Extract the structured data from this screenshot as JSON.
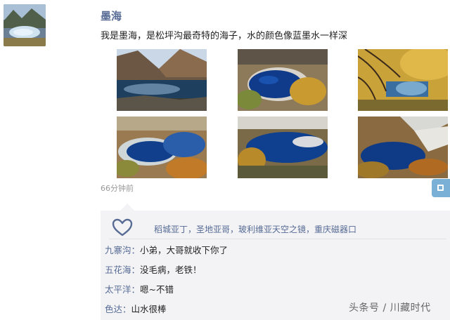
{
  "post": {
    "author": "墨海",
    "text": "我是墨海，是松坪沟最奇特的海子，水的颜色像蓝墨水一样深",
    "time": "66分钟前",
    "photo_count": 6
  },
  "likes": {
    "icon": "heart-icon",
    "names": "稻城亚丁，圣地亚哥，玻利维亚天空之镜，重庆磁器口"
  },
  "comments": [
    {
      "name": "九寨沟",
      "separator": "：",
      "text": "小弟，大哥就收下你了"
    },
    {
      "name": "五花海",
      "separator": "：",
      "text": "没毛病，老铁！"
    },
    {
      "name": "太平洋",
      "separator": "：",
      "text": "嗯~不错"
    },
    {
      "name": "色达",
      "separator": "：",
      "text": "山水很棒"
    }
  ],
  "watermark": "头条号 / 川藏时代",
  "colors": {
    "link": "#576b95",
    "comment_bg": "#f3f3f5",
    "side_tab": "#7ab0d6"
  }
}
